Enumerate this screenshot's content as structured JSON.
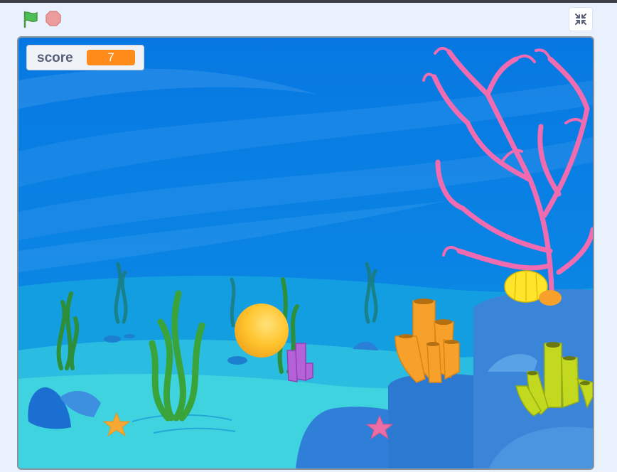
{
  "controls": {
    "green_flag": "green-flag-icon",
    "stop": "stop-icon",
    "fullscreen": "exit-fullscreen-icon"
  },
  "monitor": {
    "label": "score",
    "value": "7"
  },
  "colors": {
    "water_top": "#0a80e4",
    "sand": "#3fd3e0",
    "coral_pink": "#f06bb0",
    "ball": "#ffc42e",
    "monitor_value_bg": "#ff8c1a"
  }
}
